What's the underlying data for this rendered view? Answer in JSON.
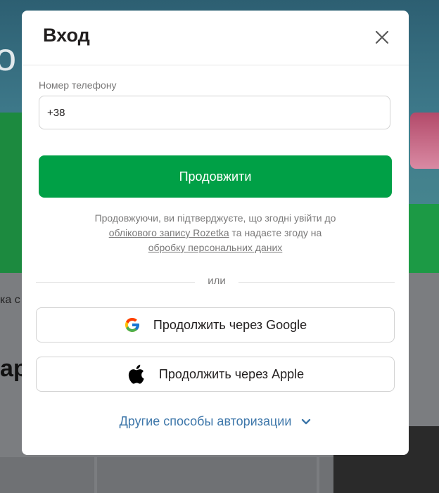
{
  "background": {
    "banner_letter": "о",
    "promo_text": "ка с",
    "section_letter": "ар"
  },
  "modal": {
    "title": "Вход",
    "close_icon": "close-icon",
    "phone": {
      "label": "Номер телефону",
      "value": "+38"
    },
    "continue_label": "Продовжити",
    "consent": {
      "line1": "Продовжуючи, ви підтверджуєте, що згодні увійти до",
      "link1": "облікового запису Rozetka",
      "middle": " та надаєте згоду на",
      "link2": "обробку персональних даних"
    },
    "divider_text": "или",
    "google_label": "Продолжить через Google",
    "apple_label": "Продолжить через Apple",
    "other_methods_label": "Другие способы авторизации"
  },
  "colors": {
    "primary_green": "#00a046",
    "link_blue": "#3e77aa",
    "text_dark": "#221f1f",
    "text_gray": "#797878"
  }
}
